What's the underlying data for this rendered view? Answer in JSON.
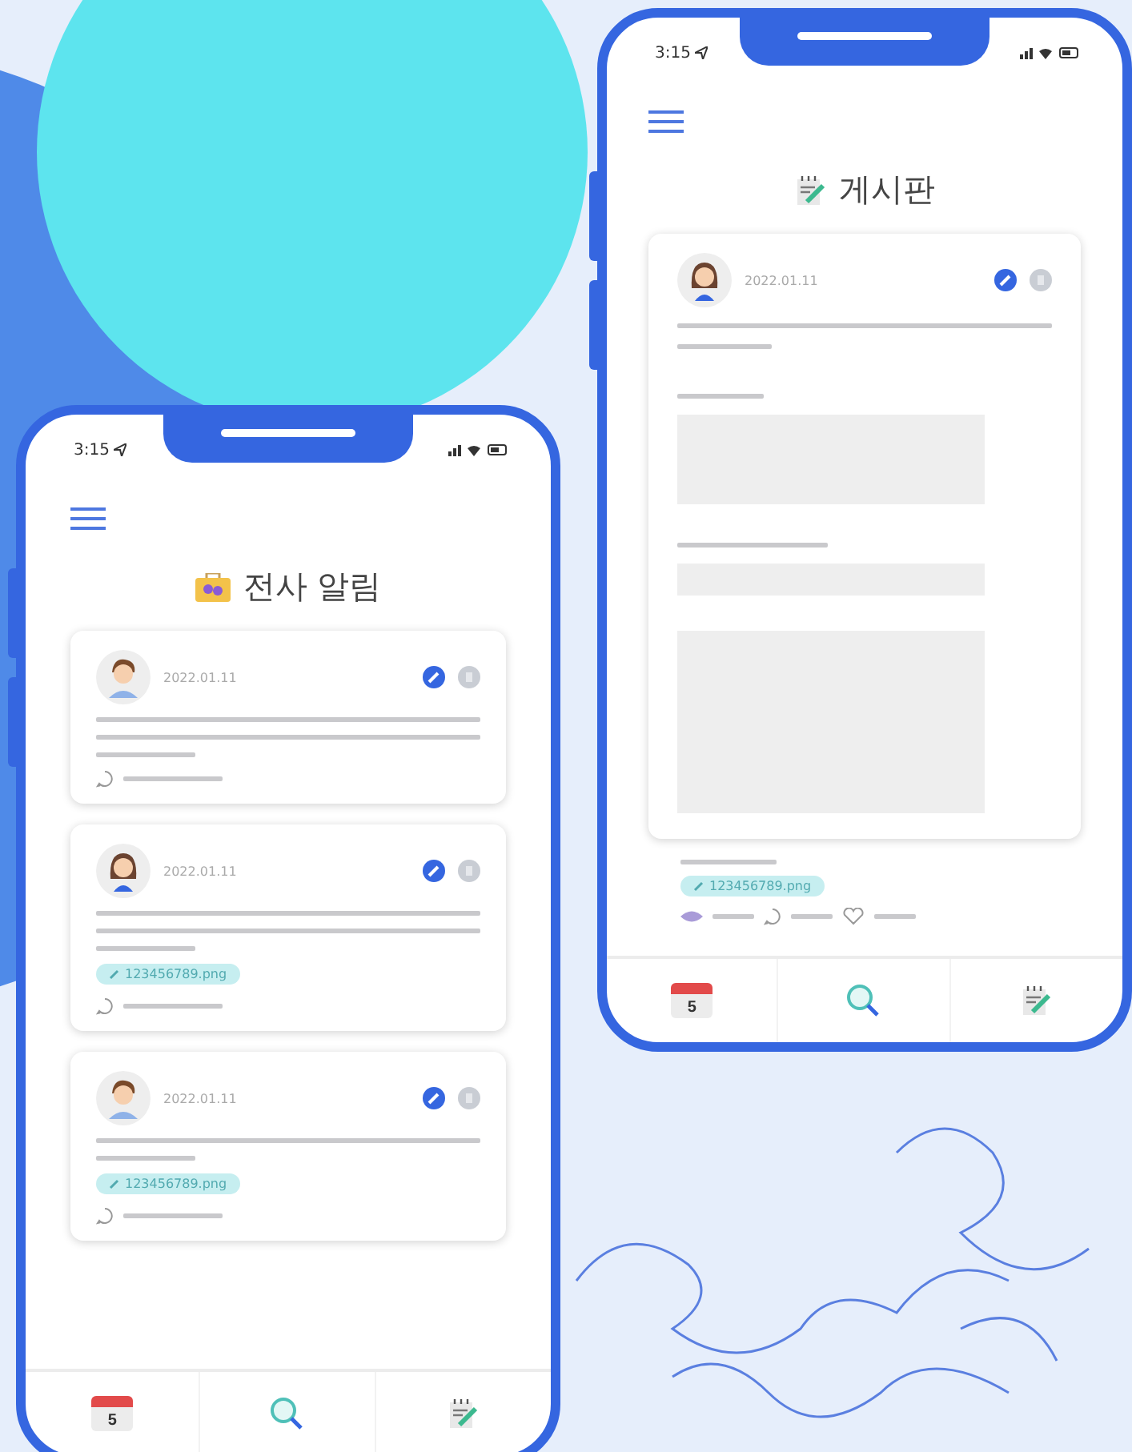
{
  "phones": [
    {
      "kind": "notices",
      "time": "3:15",
      "title": "전사 알림",
      "cards": [
        {
          "kind": "long",
          "author": {
            "kind": "man"
          },
          "date": "2022.01.11"
        },
        {
          "kind": "long",
          "author": {
            "kind": "woman"
          },
          "date": "2022.01.11",
          "attachment": "123456789.png"
        },
        {
          "kind": "brief",
          "author": {
            "kind": "man"
          },
          "date": "2022.01.11",
          "attachment": "123456789.png"
        }
      ],
      "tabs": [
        {
          "kind": "calendar",
          "label": "5"
        },
        {
          "kind": "search"
        },
        {
          "kind": "notes"
        }
      ]
    },
    {
      "kind": "board",
      "time": "3:15",
      "title": "게시판",
      "cards": [
        {
          "kind": "detail",
          "author": {
            "kind": "woman"
          },
          "date": "2022.01.11"
        }
      ],
      "attachment": "123456789.png",
      "tabs": [
        {
          "kind": "calendar",
          "label": "5"
        },
        {
          "kind": "search"
        },
        {
          "kind": "notes"
        }
      ]
    }
  ]
}
